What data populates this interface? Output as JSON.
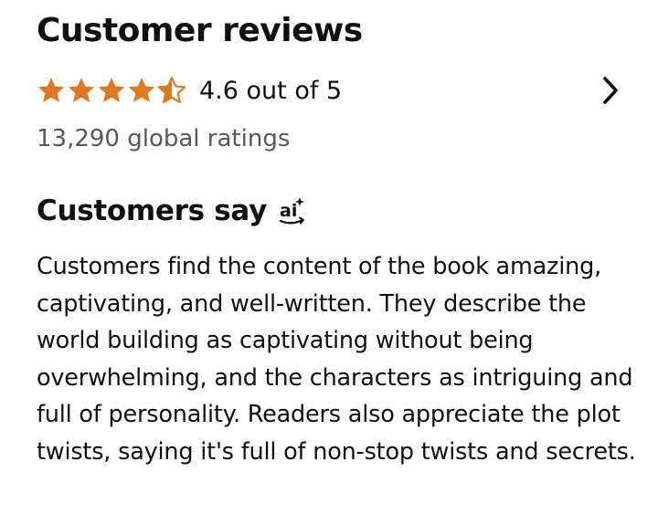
{
  "reviews": {
    "title": "Customer reviews",
    "rating": 4.6,
    "rating_text": "4.6 out of 5",
    "star_fills": [
      1,
      1,
      1,
      1,
      0.5
    ],
    "global_ratings": "13,290 global ratings",
    "star_color": "#de7921",
    "chevron_icon": "chevron-right-icon"
  },
  "customers_say": {
    "title": "Customers say",
    "ai_icon": "ai-sparkle-icon",
    "summary": "Customers find the content of the book amazing, captivating, and well-written. They describe the world building as captivating without being overwhelming, and the characters as intriguing and full of personality. Readers also appreciate the plot twists, saying it's full of non-stop twists and secrets."
  }
}
